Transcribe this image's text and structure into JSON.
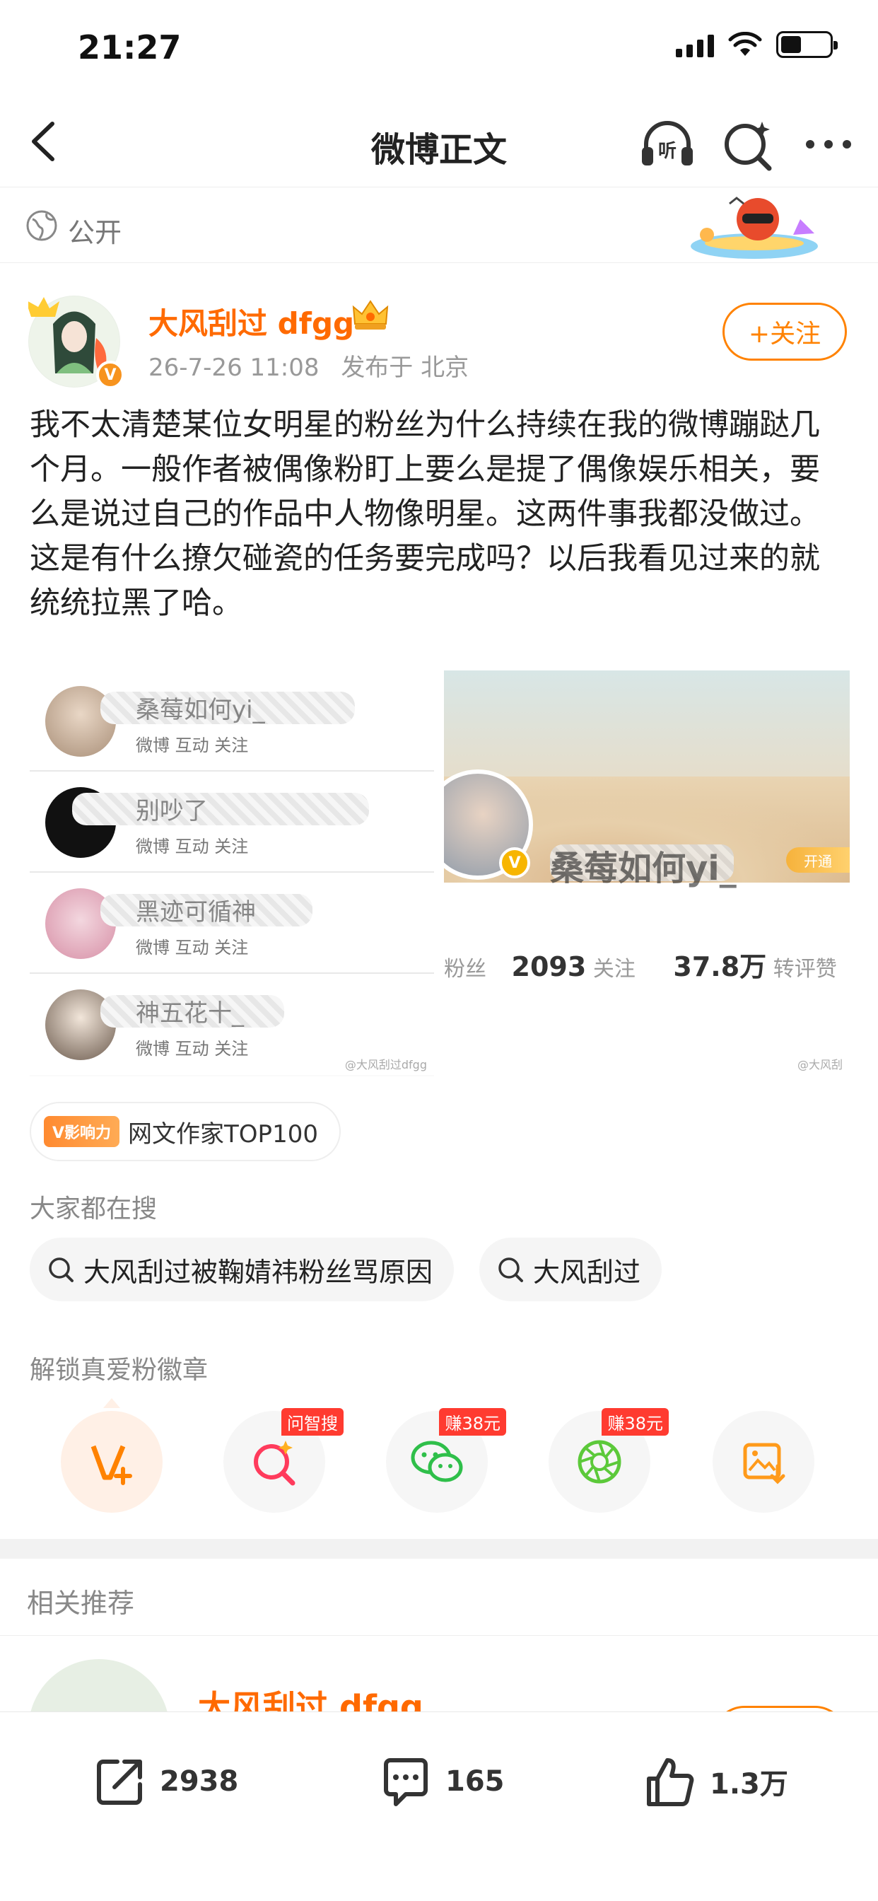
{
  "status_bar": {
    "time": "21:27"
  },
  "nav": {
    "title": "微博正文"
  },
  "visibility": {
    "label": "公开"
  },
  "author": {
    "name": "大风刮过 dfgg",
    "date": "26-7-26 11:08",
    "location": "发布于 北京",
    "follow_label": "+关注"
  },
  "post": {
    "text": "我不太清楚某位女明星的粉丝为什么持续在我的微博蹦跶几个月。一般作者被偶像粉盯上要么是提了偶像娱乐相关，要么是说过自己的作品中人物像明星。这两件事我都没做过。这是有什么撩欠碰瓷的任务要完成吗？以后我看见过来的就统统拉黑了哈。"
  },
  "images": {
    "left": {
      "rows": [
        {
          "name": "桑莓如何yi_",
          "meta": "微博 互动 关注"
        },
        {
          "name": "别吵了",
          "meta": "微博 互动 关注"
        },
        {
          "name": "黑迹可循神",
          "meta": "微博 互动 关注"
        },
        {
          "name": "神五花十_",
          "meta": "微博 互动 关注"
        }
      ],
      "watermark": "@大风刮过dfgg"
    },
    "right": {
      "name": "桑莓如何yi_",
      "open_label": "开通",
      "stats_fans_suffix": "粉丝",
      "following_count": "2093",
      "following_label": "关注",
      "likes_count": "37.8万",
      "likes_label": "转评赞",
      "watermark": "@大风刮"
    }
  },
  "influence": {
    "badge": "V影响力",
    "text": "网文作家TOP100"
  },
  "search": {
    "label": "大家都在搜",
    "chips": [
      "大风刮过被鞠婧祎粉丝骂原因",
      "大风刮过"
    ]
  },
  "badges": {
    "label": "解锁真爱粉徽章",
    "items": [
      {
        "icon": "v-plus-icon",
        "tag": ""
      },
      {
        "icon": "ask-search-icon",
        "tag": "问智搜"
      },
      {
        "icon": "wechat-icon",
        "tag": "赚38元"
      },
      {
        "icon": "moments-icon",
        "tag": "赚38元"
      },
      {
        "icon": "save-image-icon",
        "tag": ""
      }
    ]
  },
  "related": {
    "label": "相关推荐",
    "name": "大风刮过 dfgg"
  },
  "actions": {
    "repost_count": "2938",
    "comment_count": "165",
    "like_count": "1.3万"
  },
  "colors": {
    "accent": "#ff8200",
    "name": "#ff6a00",
    "red_tag": "#ff3b30"
  }
}
